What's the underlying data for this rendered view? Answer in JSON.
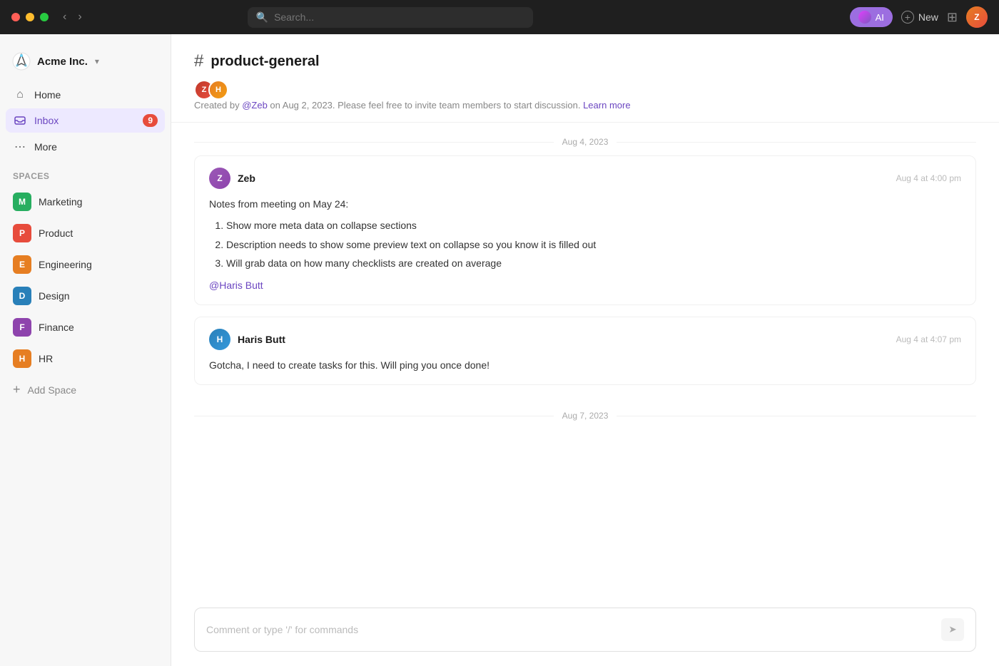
{
  "titlebar": {
    "search_placeholder": "Search...",
    "ai_label": "AI",
    "new_label": "New"
  },
  "sidebar": {
    "workspace_name": "Acme Inc.",
    "nav_items": [
      {
        "id": "home",
        "label": "Home",
        "icon": "home",
        "active": false
      },
      {
        "id": "inbox",
        "label": "Inbox",
        "icon": "inbox",
        "active": true,
        "badge": "9"
      },
      {
        "id": "more",
        "label": "More",
        "icon": "more",
        "active": false
      }
    ],
    "spaces_label": "Spaces",
    "spaces": [
      {
        "id": "marketing",
        "label": "Marketing",
        "letter": "M",
        "color": "dot-green"
      },
      {
        "id": "product",
        "label": "Product",
        "letter": "P",
        "color": "dot-red"
      },
      {
        "id": "engineering",
        "label": "Engineering",
        "letter": "E",
        "color": "dot-orange"
      },
      {
        "id": "design",
        "label": "Design",
        "letter": "D",
        "color": "dot-blue"
      },
      {
        "id": "finance",
        "label": "Finance",
        "letter": "F",
        "color": "dot-purple"
      },
      {
        "id": "hr",
        "label": "HR",
        "letter": "H",
        "color": "dot-dark-orange"
      }
    ],
    "add_space_label": "Add Space"
  },
  "channel": {
    "name": "product-general",
    "created_by": "@Zeb",
    "created_date": "Aug 2, 2023",
    "meta_text": ". Please feel free to invite team members to start discussion.",
    "learn_more": "Learn more",
    "members": [
      {
        "id": "zeb",
        "initials": "Z"
      },
      {
        "id": "haris",
        "initials": "H"
      }
    ]
  },
  "messages": {
    "date_group_1": {
      "date": "Aug 4, 2023",
      "messages": [
        {
          "id": "msg1",
          "author": "Zeb",
          "avatar_initials": "Z",
          "timestamp": "Aug 4 at 4:00 pm",
          "content_intro": "Notes from meeting on May 24:",
          "list_items": [
            "Show more meta data on collapse sections",
            "Description needs to show some preview text on collapse so you know it is filled out",
            "Will grab data on how many checklists are created on average"
          ],
          "mention": "@Haris Butt"
        },
        {
          "id": "msg2",
          "author": "Haris Butt",
          "avatar_initials": "H",
          "timestamp": "Aug 4 at 4:07 pm",
          "content": "Gotcha, I need to create tasks for this. Will ping you once done!"
        }
      ]
    },
    "date_group_2": {
      "date": "Aug 7, 2023"
    }
  },
  "comment_input": {
    "placeholder": "Comment or type '/' for commands"
  }
}
